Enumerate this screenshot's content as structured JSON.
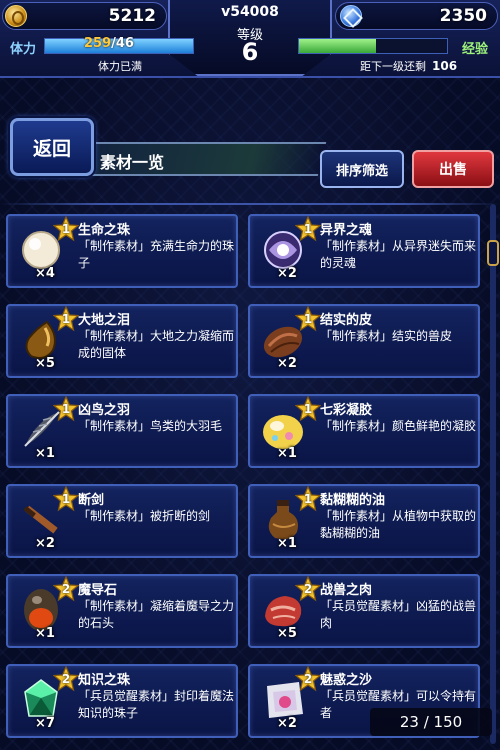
{
  "hud": {
    "gil": "5212",
    "gems": "2350",
    "player_id": "v54008",
    "level_label": "等级",
    "level": "6",
    "stamina_label": "体力",
    "stamina_current": "259",
    "stamina_max": "/46",
    "stamina_status": "体力已满",
    "stamina_fraction": 1.0,
    "exp_label": "经验",
    "exp_remaining_label": "距下一级还剩",
    "exp_remaining": "106",
    "exp_fraction": 0.52
  },
  "header": {
    "back_label": "返回",
    "title": "素材一览",
    "sort_label": "排序筛选",
    "sell_label": "出售"
  },
  "items": [
    {
      "name": "生命之珠",
      "desc": "「制作素材」充满生命力的珠子",
      "count": "×4",
      "rarity": "1",
      "icon": "pearl-orb-icon"
    },
    {
      "name": "异界之魂",
      "desc": "「制作素材」从异界迷失而来的灵魂",
      "count": "×2",
      "rarity": "1",
      "icon": "spirit-orb-icon"
    },
    {
      "name": "大地之泪",
      "desc": "「制作素材」大地之力凝缩而成的固体",
      "count": "×5",
      "rarity": "1",
      "icon": "earth-tear-icon"
    },
    {
      "name": "结实的皮",
      "desc": "「制作素材」结实的兽皮",
      "count": "×2",
      "rarity": "1",
      "icon": "hide-icon"
    },
    {
      "name": "凶鸟之羽",
      "desc": "「制作素材」鸟类的大羽毛",
      "count": "×1",
      "rarity": "1",
      "icon": "feather-icon"
    },
    {
      "name": "七彩凝胶",
      "desc": "「制作素材」颜色鲜艳的凝胶",
      "count": "×1",
      "rarity": "1",
      "icon": "gel-icon"
    },
    {
      "name": "断剑",
      "desc": "「制作素材」被折断的剑",
      "count": "×2",
      "rarity": "1",
      "icon": "broken-sword-icon"
    },
    {
      "name": "黏糊糊的油",
      "desc": "「制作素材」从植物中获取的黏糊糊的油",
      "count": "×1",
      "rarity": "1",
      "icon": "oil-flask-icon"
    },
    {
      "name": "魔导石",
      "desc": "「制作素材」凝缩着魔导之力的石头",
      "count": "×1",
      "rarity": "2",
      "icon": "magic-stone-icon"
    },
    {
      "name": "战兽之肉",
      "desc": "「兵员觉醒素材」凶猛的战兽肉",
      "count": "×5",
      "rarity": "2",
      "icon": "meat-icon"
    },
    {
      "name": "知识之珠",
      "desc": "「兵员觉醒素材」封印着魔法知识的珠子",
      "count": "×7",
      "rarity": "2",
      "icon": "green-gem-icon"
    },
    {
      "name": "魅惑之沙",
      "desc": "「兵员觉醒素材」可以令持有者",
      "count": "×2",
      "rarity": "2",
      "icon": "sand-pouch-icon"
    }
  ],
  "counter": "23 / 150",
  "colors": {
    "accent": "#3f5fb8",
    "sell": "#c8242c",
    "stamina": "#1d7fd9",
    "exp": "#3aa83a",
    "star": "#f2c230"
  }
}
